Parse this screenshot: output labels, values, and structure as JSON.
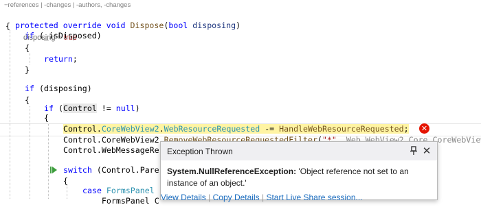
{
  "codelens": "−references | -changes | -authors, -changes",
  "datatip": {
    "name": "disposing = ",
    "value": "true"
  },
  "code": {
    "l1": {
      "kw": "protected override void",
      "fn": "Dispose",
      "p1": "(",
      "kw2": "bool",
      "pr": " disposing",
      "p2": ")"
    },
    "l2": "{",
    "l3": {
      "kw": "if",
      "rest": " (_isDisposed)"
    },
    "l4": "{",
    "l5": {
      "kw": "return",
      "rest": ";"
    },
    "l6": "}",
    "l7": {
      "kw": "if",
      "rest": " (disposing)"
    },
    "l8": "{",
    "l9": {
      "kw": "if",
      "a": " (",
      "ctl": "Control",
      "b": " != ",
      "kw2": "null",
      "c": ")"
    },
    "l10": "{",
    "l11": {
      "a": "Control",
      "b": ".",
      "c": "CoreWebView2",
      "d": ".",
      "e": "WebResourceRequested",
      "f": " -= ",
      "g": "HandleWebResourceRequested",
      "h": ";"
    },
    "l12": {
      "a": "Control.CoreWebView2.",
      "fn": "RemoveWebResourceRequestedFilter",
      "b": "(",
      "st": "\"*\"",
      "c": ", ",
      "gr": "Web.WebView2.Core.CoreWebView2"
    },
    "l13": {
      "a": "Control",
      "b": ".WebMessageRe"
    },
    "l14": {
      "kw": "switch",
      "a": " (",
      "b": "Control",
      "c": ".Pare"
    },
    "l15": "{",
    "l16": {
      "kw": "case",
      "ty": " FormsPanel"
    },
    "l17": "    FormsPanel C"
  },
  "exception": {
    "title": "Exception Thrown",
    "type": "System.NullReferenceException:",
    "message": " 'Object reference not set to an instance of an object.'",
    "links": [
      "View Details",
      "Copy Details",
      "Start Live Share session..."
    ],
    "pin_icon": "pin-icon",
    "close_icon": "close-icon"
  },
  "colors": {
    "keyword": "#0000ff",
    "type": "#2b91af",
    "method": "#74531f",
    "highlight": "#fff4a3",
    "error": "#e51400"
  }
}
